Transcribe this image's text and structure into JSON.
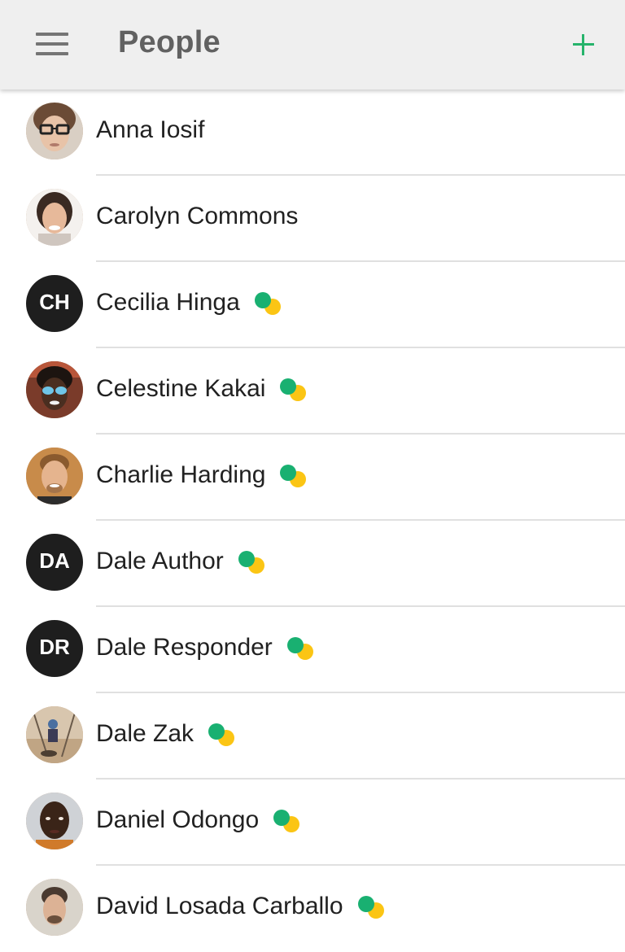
{
  "header": {
    "title": "People",
    "menu_icon": "menu-icon",
    "add_icon": "add-icon",
    "accent_color": "#26b36b"
  },
  "people": [
    {
      "name": "Anna Iosif",
      "avatar": "photo",
      "presence": false
    },
    {
      "name": "Carolyn Commons",
      "avatar": "photo",
      "presence": false
    },
    {
      "name": "Cecilia Hinga",
      "avatar": "initials",
      "initials": "CH",
      "presence": true
    },
    {
      "name": "Celestine Kakai",
      "avatar": "photo",
      "presence": true
    },
    {
      "name": "Charlie Harding",
      "avatar": "photo",
      "presence": true
    },
    {
      "name": "Dale Author",
      "avatar": "initials",
      "initials": "DA",
      "presence": true
    },
    {
      "name": "Dale Responder",
      "avatar": "initials",
      "initials": "DR",
      "presence": true
    },
    {
      "name": "Dale Zak",
      "avatar": "photo",
      "presence": true
    },
    {
      "name": "Daniel Odongo",
      "avatar": "photo",
      "presence": true
    },
    {
      "name": "David Losada Carballo",
      "avatar": "photo",
      "presence": true
    }
  ],
  "colors": {
    "presence_green": "#19b071",
    "presence_yellow": "#fbc514",
    "initials_background": "#1e1e1e"
  }
}
